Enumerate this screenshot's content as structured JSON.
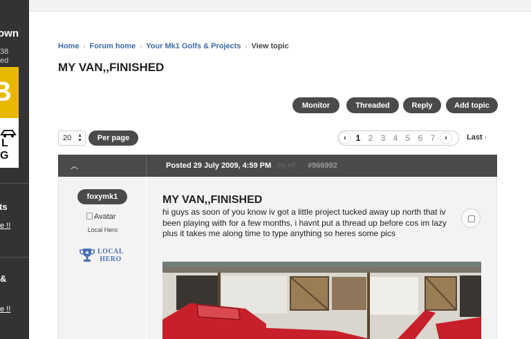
{
  "sidebar": {
    "heading_1": "own",
    "small_1": "38",
    "small_2": "ed",
    "yellow_letter": "B",
    "white_letter_1": "L",
    "white_letter_2": "G",
    "heading_2": "ts",
    "link_1": "e !!",
    "heading_3": "&",
    "link_2": "e !!"
  },
  "breadcrumb": {
    "items": [
      "Home",
      "Forum home",
      "Your Mk1 Golfs & Projects"
    ],
    "current": "View topic"
  },
  "topic": {
    "title": "MY VAN,,FINISHED"
  },
  "actions": {
    "monitor": "Monitor",
    "threaded": "Threaded",
    "reply": "Reply",
    "add_topic": "Add topic"
  },
  "per_page": {
    "selected": "20",
    "button": "Per page"
  },
  "pagination": {
    "prev": "‹",
    "next": "›",
    "pages": [
      "1",
      "2",
      "3",
      "4",
      "5",
      "6",
      "7"
    ],
    "current": "1",
    "last": "Last"
  },
  "post": {
    "posted": "Posted 29 July 2009, 4:59 PM",
    "id": "#966992",
    "author": "foxymk1",
    "avatar_alt": "Avatar",
    "rank": "Local Hero",
    "rank_badge_line1": "LOCAL",
    "rank_badge_line2": "HERO",
    "title": "MY VAN,,FINISHED",
    "body": "hi guys as soon of you know iv got a little project tucked away up north that iv been playing with for a few months, i havnt put a thread up before cos im lazy plus it takes me along time to type anything so heres some pics"
  },
  "colors": {
    "sidebar": "#333333",
    "pill": "#4a4a4a",
    "link": "#3d6ba8",
    "badge": "#e8b800"
  }
}
